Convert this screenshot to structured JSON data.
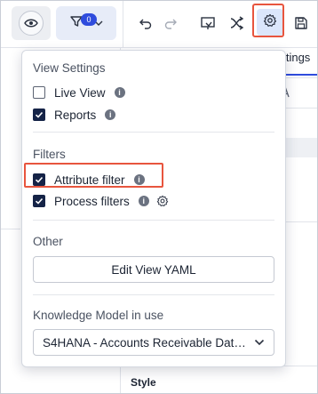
{
  "toolbar": {
    "filter_badge_count": "0",
    "icons": [
      "eye-icon",
      "filter-icon",
      "chevron-down-icon",
      "undo-icon",
      "redo-icon",
      "presentation-icon",
      "shuffle-icon",
      "gear-icon",
      "save-icon"
    ]
  },
  "background": {
    "settings_tab_label": "ettings",
    "partial_text": "s",
    "style_label": "Style"
  },
  "dropdown": {
    "view_settings": {
      "title": "View Settings",
      "items": [
        {
          "label": "Live View",
          "checked": false
        },
        {
          "label": "Reports",
          "checked": true
        }
      ]
    },
    "filters": {
      "title": "Filters",
      "items": [
        {
          "label": "Attribute filter",
          "checked": true
        },
        {
          "label": "Process filters",
          "checked": true
        }
      ]
    },
    "other": {
      "title": "Other",
      "button_label": "Edit View YAML"
    },
    "knowledge_model": {
      "title": "Knowledge Model in use",
      "selected": "S4HANA - Accounts Receivable Data Model"
    }
  },
  "colors": {
    "accent": "#2f4cdd",
    "checkbox_checked": "#152347",
    "highlight": "#e8553e"
  }
}
